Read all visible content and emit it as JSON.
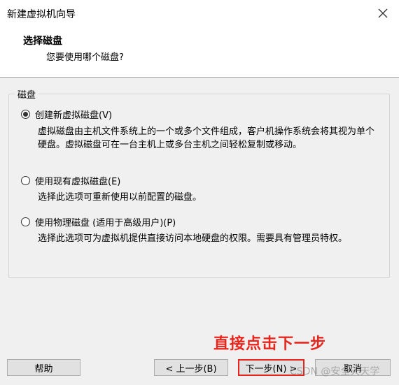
{
  "window": {
    "title": "新建虚拟机向导"
  },
  "header": {
    "title": "选择磁盘",
    "subtitle": "您要使用哪个磁盘?"
  },
  "group": {
    "legend": "磁盘"
  },
  "options": [
    {
      "label": "创建新虚拟磁盘(V)",
      "selected": true,
      "description": "虚拟磁盘由主机文件系统上的一个或多个文件组成，客户机操作系统会将其视为单个硬盘。虚拟磁盘可在一台主机上或多台主机之间轻松复制或移动。"
    },
    {
      "label": "使用现有虚拟磁盘(E)",
      "selected": false,
      "description": "选择此选项可重新使用以前配置的磁盘。"
    },
    {
      "label": "使用物理磁盘 (适用于高级用户)(P)",
      "selected": false,
      "description": "选择此选项可为虚拟机提供直接访问本地硬盘的权限。需要具有管理员特权。"
    }
  ],
  "annotation": "直接点击下一步",
  "buttons": {
    "help": "帮助",
    "back": "< 上一步(B)",
    "next": "下一步(N) >",
    "cancel": "取消"
  },
  "watermark": "CSDN @安全天天学",
  "colors": {
    "accent_red": "#e8251c",
    "background": "#f0f0f0"
  }
}
